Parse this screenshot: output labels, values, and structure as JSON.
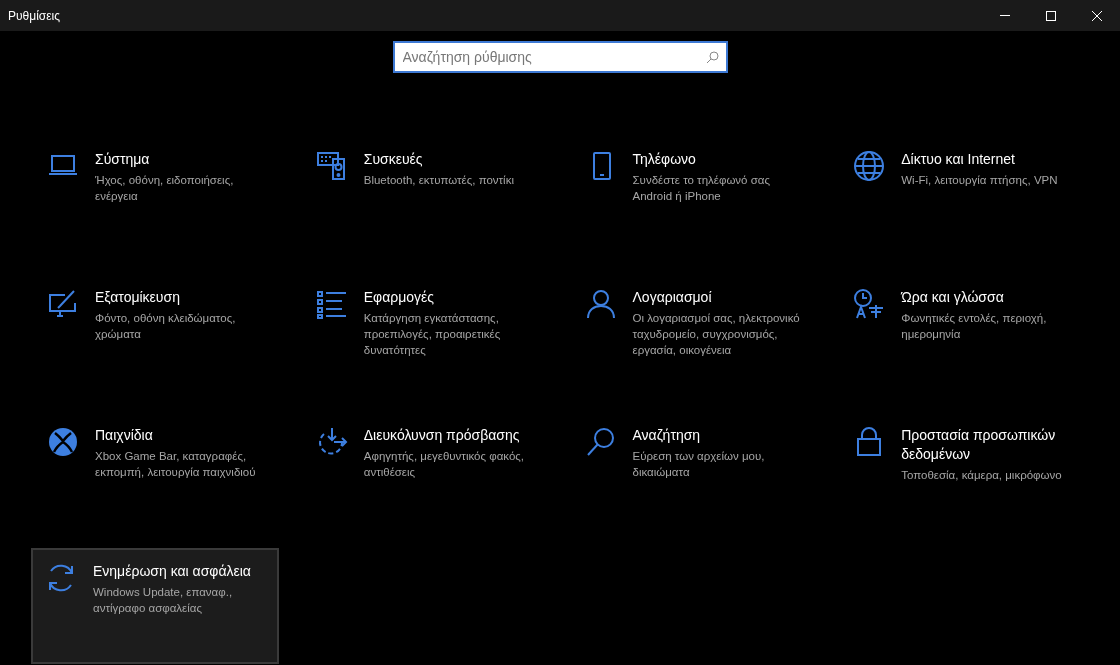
{
  "window": {
    "title": "Ρυθμίσεις"
  },
  "search": {
    "placeholder": "Αναζήτηση ρύθμισης",
    "focused": true
  },
  "categories": [
    {
      "kind": "laptop",
      "title": "Σύστημα",
      "description": "Ήχος, οθόνη, ειδοποιήσεις, ενέργεια",
      "hovered": false
    },
    {
      "kind": "devices",
      "title": "Συσκευές",
      "description": "Bluetooth, εκτυπωτές, ποντίκι",
      "hovered": false
    },
    {
      "kind": "phone",
      "title": "Τηλέφωνο",
      "description": "Συνδέστε το τηλέφωνό σας Android ή iPhone",
      "hovered": false
    },
    {
      "kind": "globe",
      "title": "Δίκτυο και Internet",
      "description": "Wi-Fi, λειτουργία πτήσης, VPN",
      "hovered": false
    },
    {
      "kind": "paint",
      "title": "Εξατομίκευση",
      "description": "Φόντο, οθόνη κλειδώματος, χρώματα",
      "hovered": false
    },
    {
      "kind": "apps",
      "title": "Εφαρμογές",
      "description": "Κατάργηση εγκατάστασης, προεπιλογές, προαιρετικές δυνατότητες",
      "hovered": false
    },
    {
      "kind": "person",
      "title": "Λογαριασμοί",
      "description": "Οι λογαριασμοί σας, ηλεκτρονικό ταχυδρομείο, συγχρονισμός, εργασία, οικογένεια",
      "hovered": false
    },
    {
      "kind": "time",
      "title": "Ώρα και γλώσσα",
      "description": "Φωνητικές εντολές, περιοχή, ημερομηνία",
      "hovered": false
    },
    {
      "kind": "xbox",
      "title": "Παιχνίδια",
      "description": "Xbox Game Bar, καταγραφές, εκπομπή, λειτουργία παιχνιδιού",
      "hovered": false
    },
    {
      "kind": "access",
      "title": "Διευκόλυνση πρόσβασης",
      "description": "Αφηγητής, μεγεθυντικός φακός, αντιθέσεις",
      "hovered": false
    },
    {
      "kind": "search",
      "title": "Αναζήτηση",
      "description": "Εύρεση των αρχείων μου, δικαιώματα",
      "hovered": false
    },
    {
      "kind": "lock",
      "title": "Προστασία προσωπικών δεδομένων",
      "description": "Τοποθεσία, κάμερα, μικρόφωνο",
      "hovered": false
    },
    {
      "kind": "sync",
      "title": "Ενημέρωση και ασφάλεια",
      "description": "Windows Update, επαναφ., αντίγραφο ασφαλείας",
      "hovered": true
    }
  ]
}
